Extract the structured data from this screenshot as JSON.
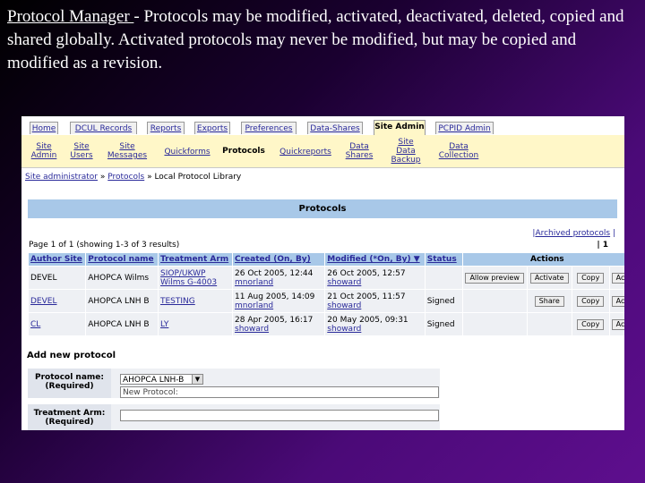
{
  "slide": {
    "title_part": "Protocol Manager ",
    "text": "- Protocols may be modified, activated, deactivated, deleted, copied and shared globally. Activated protocols may never be modified, but may be copied and modified as a revision."
  },
  "tabs": [
    "Home",
    "DCUL Records",
    "Reports",
    "Exports",
    "Preferences",
    "Data-Shares",
    "Site Admin",
    "PCPID Admin"
  ],
  "subnav": [
    {
      "line1": "Site",
      "line2": "Admin"
    },
    {
      "line1": "Site",
      "line2": "Users"
    },
    {
      "line1": "Site",
      "line2": "Messages"
    },
    {
      "line1": "Quickforms",
      "line2": ""
    },
    {
      "line1": "Protocols",
      "line2": ""
    },
    {
      "line1": "Quickreports",
      "line2": ""
    },
    {
      "line1": "Data",
      "line2": "Shares"
    },
    {
      "line1": "Site",
      "line2": "Data",
      "line3": "Backup"
    },
    {
      "line1": "Data",
      "line2": "Collection"
    }
  ],
  "breadcrumb": {
    "a": "Site administrator",
    "sep1": " » ",
    "b": "Protocols",
    "sep2": " » Local Protocol Library"
  },
  "section_title": "Protocols",
  "archived_link": "Archived protocols",
  "page_info": "Page 1 of 1 (showing 1-3 of 3 results)",
  "page_num": "| 1",
  "columns": [
    "Author Site",
    "Protocol name",
    "Treatment Arm",
    "Created (On, By)",
    "Modified (*On, By) ▼",
    "Status",
    "Actions"
  ],
  "rows": [
    {
      "site": "DEVEL",
      "name": "AHOPCA Wilms",
      "arm1": "SIOP/UKWP",
      "arm2": "Wilms G-4003",
      "c1": "26 Oct 2005, 12:44",
      "c2": "mnorland",
      "m1": "26 Oct 2005, 12:57",
      "m2": "showard",
      "status": "",
      "b1": "Allow preview",
      "b2": "Activate",
      "b3": "Copy",
      "b4": "Ac"
    },
    {
      "site": "DEVEL",
      "name": "AHOPCA LNH B",
      "arm1": "TESTING",
      "arm2": "",
      "c1": "11 Aug 2005, 14:09",
      "c2": "mnorland",
      "m1": "21 Oct 2005, 11:57",
      "m2": "showard",
      "status": "Signed",
      "b1": "",
      "b2": "Share",
      "b3": "Copy",
      "b4": "Ac"
    },
    {
      "site": "CL",
      "name": "AHOPCA LNH B",
      "arm1": "LY",
      "arm2": "",
      "c1": "28 Apr 2005, 16:17",
      "c2": "showard",
      "m1": "20 May 2005, 09:31",
      "m2": "showard",
      "status": "Signed",
      "b1": "",
      "b2": "",
      "b3": "Copy",
      "b4": "Ac"
    }
  ],
  "add_title": "Add new protocol",
  "form": {
    "protocol_label": "Protocol name: (Required)",
    "protocol_select": "AHOPCA LNH-B",
    "new_protocol": "New Protocol:",
    "arm_label": "Treatment Arm: (Required)"
  }
}
